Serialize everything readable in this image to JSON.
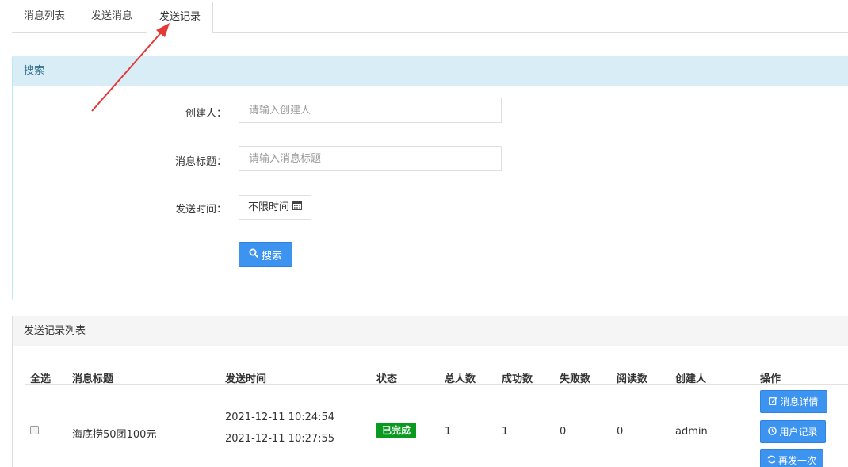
{
  "tabs": [
    {
      "label": "消息列表"
    },
    {
      "label": "发送消息"
    },
    {
      "label": "发送记录"
    }
  ],
  "search": {
    "title": "搜索",
    "creator_label": "创建人：",
    "creator_placeholder": "请输入创建人",
    "msg_title_label": "消息标题：",
    "msg_title_placeholder": "请输入消息标题",
    "time_label": "发送时间：",
    "time_value": "不限时间",
    "search_button": "搜索"
  },
  "list": {
    "title": "发送记录列表",
    "columns": [
      "全选",
      "消息标题",
      "发送时间",
      "状态",
      "总人数",
      "成功数",
      "失败数",
      "阅读数",
      "创建人",
      "操作"
    ],
    "rows": [
      {
        "title": "海底捞50团100元",
        "send_time_start": "2021-12-11 10:24:54",
        "send_time_end": "2021-12-11 10:27:55",
        "status": "已完成",
        "total": "1",
        "success": "1",
        "failed": "0",
        "read": "0",
        "creator": "admin",
        "actions": [
          "消息详情",
          "用户记录",
          "再发一次"
        ]
      }
    ]
  },
  "colors": {
    "primary": "#3d93f0",
    "success": "#0a9a1f",
    "info_bg": "#d9edf7",
    "annotation_arrow": "#e53935"
  },
  "icons": {
    "calendar": "calendar-icon",
    "search": "search-icon",
    "edit": "edit-icon",
    "clock": "clock-icon",
    "refresh": "refresh-icon"
  }
}
